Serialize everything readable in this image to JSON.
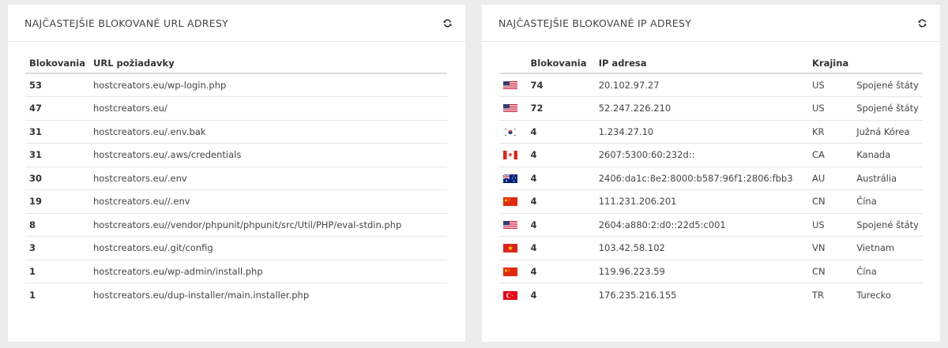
{
  "urls_panel": {
    "title": "Najčastejšie blokované URL adresy",
    "columns": [
      "Blokovania",
      "URL požiadavky"
    ],
    "rows": [
      {
        "count": "53",
        "url": "hostcreators.eu/wp-login.php"
      },
      {
        "count": "47",
        "url": "hostcreators.eu/"
      },
      {
        "count": "31",
        "url": "hostcreators.eu/.env.bak"
      },
      {
        "count": "31",
        "url": "hostcreators.eu/.aws/credentials"
      },
      {
        "count": "30",
        "url": "hostcreators.eu/.env"
      },
      {
        "count": "19",
        "url": "hostcreators.eu//.env"
      },
      {
        "count": "8",
        "url": "hostcreators.eu//vendor/phpunit/phpunit/src/Util/PHP/eval-stdin.php"
      },
      {
        "count": "3",
        "url": "hostcreators.eu/.git/config"
      },
      {
        "count": "1",
        "url": "hostcreators.eu/wp-admin/install.php"
      },
      {
        "count": "1",
        "url": "hostcreators.eu/dup-installer/main.installer.php"
      }
    ]
  },
  "ips_panel": {
    "title": "Najčastejšie blokované IP adresy",
    "columns": [
      "",
      "Blokovania",
      "IP adresa",
      "Krajina",
      ""
    ],
    "rows": [
      {
        "flag": "us-flag-icon",
        "count": "74",
        "ip": "20.102.97.27",
        "code": "US",
        "country": "Spojené štáty"
      },
      {
        "flag": "us-flag-icon",
        "count": "72",
        "ip": "52.247.226.210",
        "code": "US",
        "country": "Spojené štáty"
      },
      {
        "flag": "kr-flag-icon",
        "count": "4",
        "ip": "1.234.27.10",
        "code": "KR",
        "country": "Južná Kórea"
      },
      {
        "flag": "ca-flag-icon",
        "count": "4",
        "ip": "2607:5300:60:232d::",
        "code": "CA",
        "country": "Kanada"
      },
      {
        "flag": "au-flag-icon",
        "count": "4",
        "ip": "2406:da1c:8e2:8000:b587:96f1:2806:fbb3",
        "code": "AU",
        "country": "Austrália"
      },
      {
        "flag": "cn-flag-icon",
        "count": "4",
        "ip": "111.231.206.201",
        "code": "CN",
        "country": "Čína"
      },
      {
        "flag": "us-flag-icon",
        "count": "4",
        "ip": "2604:a880:2:d0::22d5:c001",
        "code": "US",
        "country": "Spojené štáty"
      },
      {
        "flag": "vn-flag-icon",
        "count": "4",
        "ip": "103.42.58.102",
        "code": "VN",
        "country": "Vietnam"
      },
      {
        "flag": "cn-flag-icon",
        "count": "4",
        "ip": "119.96.223.59",
        "code": "CN",
        "country": "Čína"
      },
      {
        "flag": "tr-flag-icon",
        "count": "4",
        "ip": "176.235.216.155",
        "code": "TR",
        "country": "Turecko"
      }
    ]
  },
  "colors": {
    "page_bg": "#ececec",
    "panel_bg": "#ffffff",
    "text": "#333333"
  }
}
